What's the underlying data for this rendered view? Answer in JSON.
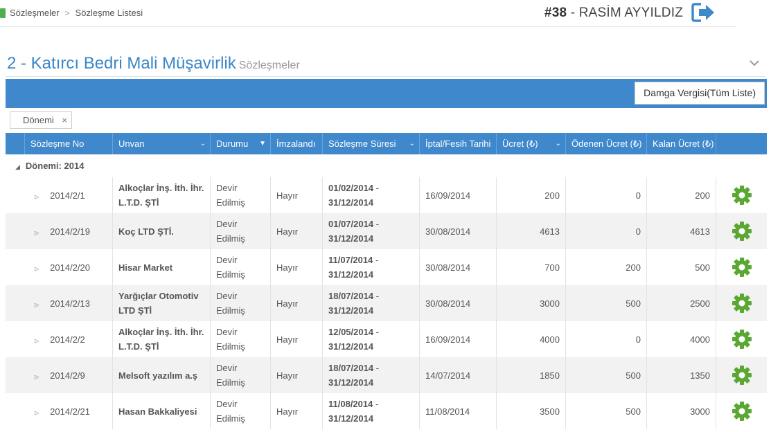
{
  "breadcrumb": {
    "items": [
      "Sözleşmeler",
      "Sözleşme Listesi"
    ],
    "separator": ">"
  },
  "user": {
    "number": "#38",
    "dash": " - ",
    "name": "RASİM AYYILDIZ"
  },
  "page": {
    "title": "2 - Katırcı Bedri Mali Müşavirlik",
    "subtitle": "Sözleşmeler"
  },
  "toolbar": {
    "damga_label": "Damga Vergisi(Tüm Liste)"
  },
  "filter": {
    "chip_label": "Dönemi",
    "chip_close": "×"
  },
  "group": {
    "label": "Dönemi: 2014"
  },
  "columns": [
    "Sözleşme No",
    "Unvan",
    "Durumu",
    "İmzalandı",
    "Sözleşme Süresi",
    "İptal/Fesih Tarihi",
    "Ücret (₺)",
    "Ödenen Ücret (₺)",
    "Kalan Ücret (₺)"
  ],
  "rows": [
    {
      "no": "2014/2/1",
      "unvan": "Alkoçlar İnş. İth. İhr. L.T.D. ŞTİ",
      "durum": "Devir Edilmiş",
      "imza": "Hayır",
      "sure_start": "01/02/2014",
      "sure_end": "31/12/2014",
      "iptal": "16/09/2014",
      "ucret": "200",
      "odenen": "0",
      "kalan": "200"
    },
    {
      "no": "2014/2/19",
      "unvan": "Koç LTD ŞTİ.",
      "durum": "Devir Edilmiş",
      "imza": "Hayır",
      "sure_start": "01/07/2014",
      "sure_end": "31/12/2014",
      "iptal": "30/08/2014",
      "ucret": "4613",
      "odenen": "0",
      "kalan": "4613"
    },
    {
      "no": "2014/2/20",
      "unvan": "Hisar Market",
      "durum": "Devir Edilmiş",
      "imza": "Hayır",
      "sure_start": "11/07/2014",
      "sure_end": "31/12/2014",
      "iptal": "30/08/2014",
      "ucret": "700",
      "odenen": "200",
      "kalan": "500"
    },
    {
      "no": "2014/2/13",
      "unvan": "Yarğıçlar Otomotiv LTD ŞTİ",
      "durum": "Devir Edilmiş",
      "imza": "Hayır",
      "sure_start": "18/07/2014",
      "sure_end": "31/12/2014",
      "iptal": "30/08/2014",
      "ucret": "3000",
      "odenen": "500",
      "kalan": "2500"
    },
    {
      "no": "2014/2/2",
      "unvan": "Alkoçlar İnş. İth. İhr. L.T.D. ŞTİ",
      "durum": "Devir Edilmiş",
      "imza": "Hayır",
      "sure_start": "12/05/2014",
      "sure_end": "31/12/2014",
      "iptal": "16/09/2014",
      "ucret": "4000",
      "odenen": "0",
      "kalan": "4000"
    },
    {
      "no": "2014/2/9",
      "unvan": "Melsoft yazılım a.ş",
      "durum": "Devir Edilmiş",
      "imza": "Hayır",
      "sure_start": "18/07/2014",
      "sure_end": "31/12/2014",
      "iptal": "14/07/2014",
      "ucret": "1850",
      "odenen": "500",
      "kalan": "1350"
    },
    {
      "no": "2014/2/21",
      "unvan": "Hasan Bakkaliyesi",
      "durum": "Devir Edilmiş",
      "imza": "Hayır",
      "sure_start": "11/08/2014",
      "sure_end": "31/12/2014",
      "iptal": "11/08/2014",
      "ucret": "3500",
      "odenen": "500",
      "kalan": "3000"
    }
  ],
  "colors": {
    "accent": "#3f88cc",
    "title": "#3a87c8",
    "gear": "#5aa832",
    "logout": "#3f88cc"
  },
  "icons": {
    "row_action": "gear-icon",
    "logout": "logout-icon",
    "collapse": "chevron-down-icon"
  }
}
